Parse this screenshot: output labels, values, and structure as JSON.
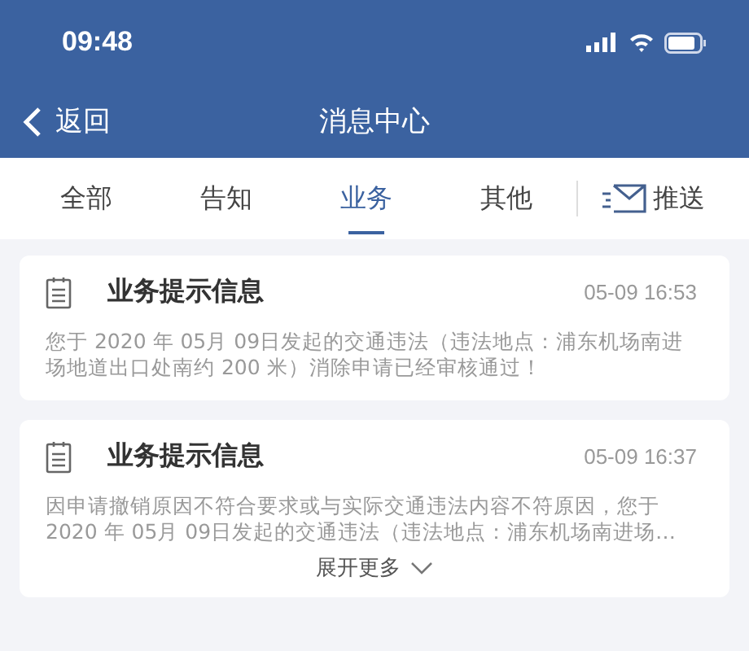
{
  "status_bar": {
    "time": "09:48"
  },
  "nav": {
    "back": "返回",
    "title": "消息中心"
  },
  "tabs": [
    {
      "label": "全部",
      "selected": false
    },
    {
      "label": "告知",
      "selected": false
    },
    {
      "label": "业务",
      "selected": true
    },
    {
      "label": "其他",
      "selected": false
    }
  ],
  "push_button": {
    "label": "推送"
  },
  "messages": [
    {
      "title": "业务提示信息",
      "time": "05-09 16:53",
      "body": "您于 2020 年 05月 09日发起的交通违法（违法地点：浦东机场南进场地道出口处南约 200 米）消除申请已经审核通过！"
    },
    {
      "title": "业务提示信息",
      "time": "05-09 16:37",
      "body": "因申请撤销原因不符合要求或与实际交通违法内容不符原因，您于 2020 年 05月 09日发起的交通违法（违法地点：浦东机场南进场…",
      "more": "展开更多"
    }
  ]
}
